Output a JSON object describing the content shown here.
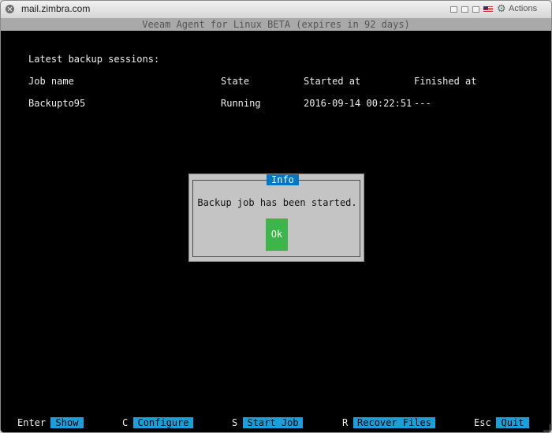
{
  "window": {
    "title": "mail.zimbra.com",
    "actions_label": "Actions"
  },
  "terminal": {
    "banner": "Veeam Agent for Linux BETA (expires in 92 days)",
    "sessions_heading": "Latest backup sessions:",
    "columns": [
      "Job name",
      "State",
      "Started at",
      "Finished at"
    ],
    "rows": [
      {
        "job_name": "Backupto95",
        "state": "Running",
        "started_at": "2016-09-14 00:22:51",
        "finished_at": "---"
      }
    ]
  },
  "dialog": {
    "title": "Info",
    "message": "Backup job has been started.",
    "ok_label": "Ok"
  },
  "hotkeys": [
    {
      "key": "Enter",
      "action": "Show"
    },
    {
      "key": "C",
      "action": "Configure"
    },
    {
      "key": "S",
      "action": "Start Job"
    },
    {
      "key": "R",
      "action": "Recover Files"
    },
    {
      "key": "Esc",
      "action": "Quit"
    }
  ],
  "colors": {
    "terminal_bg": "#000000",
    "dialog_bg": "#c4c4c4",
    "dialog_title_bg": "#0077c0",
    "ok_button": "#3cb54a",
    "hotkey_bg": "#1a9fd8"
  },
  "icons": [
    "close-icon",
    "flag-icon",
    "gear-icon"
  ]
}
